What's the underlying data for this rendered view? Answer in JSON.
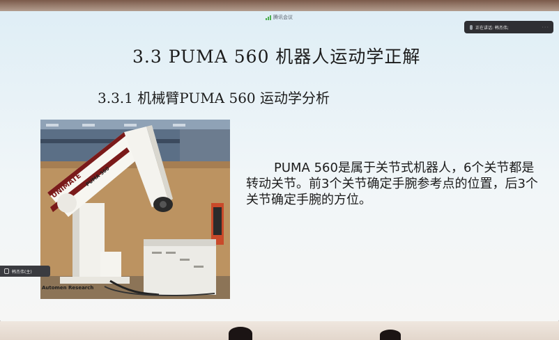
{
  "meeting": {
    "app_label": "腾讯会议",
    "speaking_indicator": "正在讲话: 韩杰伟;",
    "participant_badge": "韩杰伟(主)"
  },
  "slide": {
    "title": "3.3 PUMA 560 机器人运动学正解",
    "subtitle": "3.3.1  机械臂PUMA 560 运动学分析",
    "body": "PUMA 560是属于关节式机器人，6个关节都是转动关节。前3个关节确定手腕参考点的位置，后3个关节确定手腕的方位。",
    "photo": {
      "arm_label": "UNIMATE",
      "arm_model": "PUMA 560",
      "caption": "Automen Research"
    }
  },
  "icons": {
    "signal": "signal-bars-icon",
    "mic": "microphone-icon",
    "mic_muted": "microphone-muted-icon"
  },
  "colors": {
    "screen_bg": "#e9f3f7",
    "text": "#1c1c1c",
    "indicator_bg": "#2f2f33",
    "signal_green": "#4caf50"
  }
}
